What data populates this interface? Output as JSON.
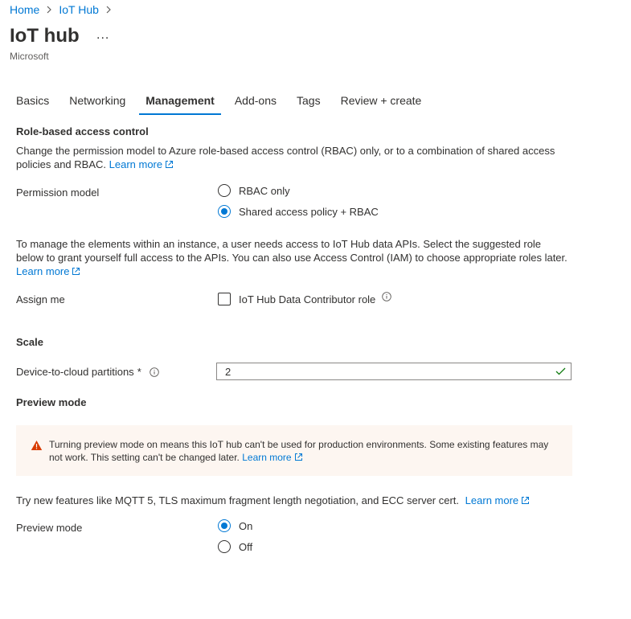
{
  "breadcrumb": {
    "home": "Home",
    "iothub": "IoT Hub"
  },
  "header": {
    "title": "IoT hub",
    "more": "...",
    "subtitle": "Microsoft"
  },
  "tabs": [
    {
      "label": "Basics"
    },
    {
      "label": "Networking"
    },
    {
      "label": "Management"
    },
    {
      "label": "Add-ons"
    },
    {
      "label": "Tags"
    },
    {
      "label": "Review + create"
    }
  ],
  "rbac": {
    "heading": "Role-based access control",
    "description": "Change the permission model to Azure role-based access control (RBAC) only, or to a combination of shared access policies and RBAC.",
    "learn_more": "Learn more",
    "permission_label": "Permission model",
    "options": {
      "rbac_only": "RBAC only",
      "shared": "Shared access policy + RBAC"
    },
    "selected": "shared"
  },
  "assign": {
    "description": "To manage the elements within an instance, a user needs access to IoT Hub data APIs. Select the suggested role below to grant yourself full access to the APIs. You can also use Access Control (IAM) to choose appropriate roles later.",
    "learn_more": "Learn more",
    "label": "Assign me",
    "checkbox_label": "IoT Hub Data Contributor role"
  },
  "scale": {
    "heading": "Scale",
    "partitions_label": "Device-to-cloud partitions",
    "required_mark": "*",
    "partitions_value": "2"
  },
  "preview": {
    "heading": "Preview mode",
    "warning": "Turning preview mode on means this IoT hub can't be used for production environments. Some existing features may not work. This setting can't be changed later.",
    "warning_learn_more": "Learn more",
    "try_text": "Try new features like MQTT 5, TLS maximum fragment length negotiation, and ECC server cert.",
    "try_learn_more": "Learn more",
    "label": "Preview mode",
    "options": {
      "on": "On",
      "off": "Off"
    },
    "selected": "on"
  },
  "colors": {
    "accent": "#0078d4",
    "warning": "#d83b01",
    "success": "#107c10",
    "warning_bg": "#fdf6f1"
  }
}
